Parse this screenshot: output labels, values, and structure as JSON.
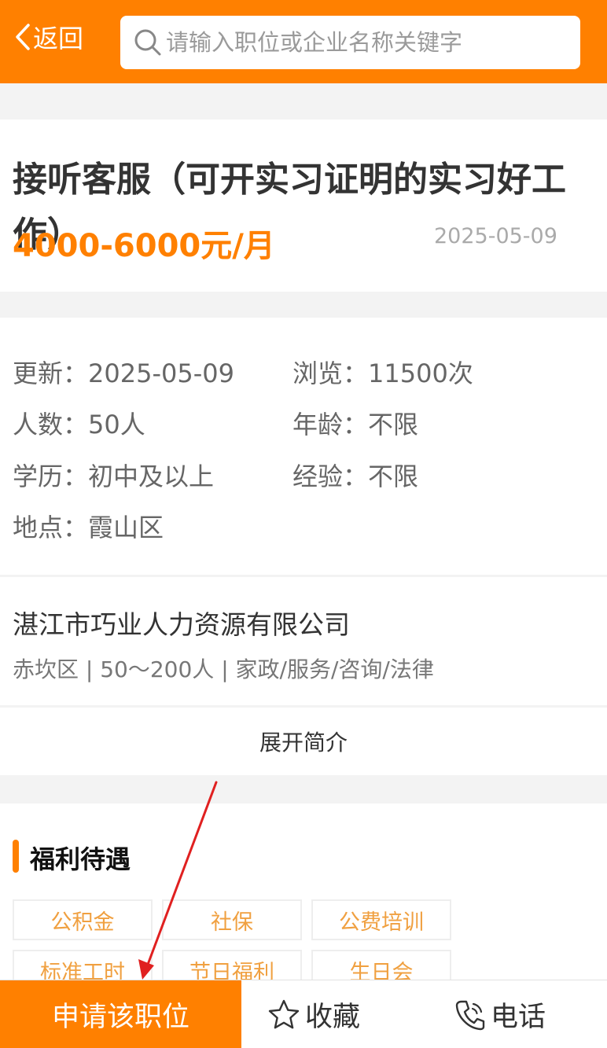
{
  "header": {
    "back_label": "返回",
    "search_placeholder": "请输入职位或企业名称关键字"
  },
  "job": {
    "title": "接听客服（可开实习证明的实习好工作）",
    "salary": "4000-6000元/月",
    "post_date": "2025-05-09"
  },
  "info": [
    {
      "label": "更新：",
      "value": "2025-05-09"
    },
    {
      "label": "浏览：",
      "value": "11500次"
    },
    {
      "label": "人数：",
      "value": "50人"
    },
    {
      "label": "年龄：",
      "value": "不限"
    },
    {
      "label": "学历：",
      "value": "初中及以上"
    },
    {
      "label": "经验：",
      "value": "不限"
    },
    {
      "label": "地点：",
      "value": "霞山区"
    }
  ],
  "company": {
    "name": "湛江市巧业人力资源有限公司",
    "meta": "赤坎区 | 50～200人 | 家政/服务/咨询/法律",
    "expand_label": "展开简介"
  },
  "welfare": {
    "title": "福利待遇",
    "tags": [
      "公积金",
      "社保",
      "公费培训",
      "标准工时",
      "节日福利",
      "生日会"
    ]
  },
  "bottom": {
    "apply_label": "申请该职位",
    "favorite_label": "收藏",
    "phone_label": "电话"
  },
  "colors": {
    "accent": "#ff8000",
    "annotation_arrow": "#e02020"
  },
  "icons": {
    "back": "chevron-left-icon",
    "search": "search-icon",
    "favorite": "star-icon",
    "phone": "phone-icon"
  }
}
